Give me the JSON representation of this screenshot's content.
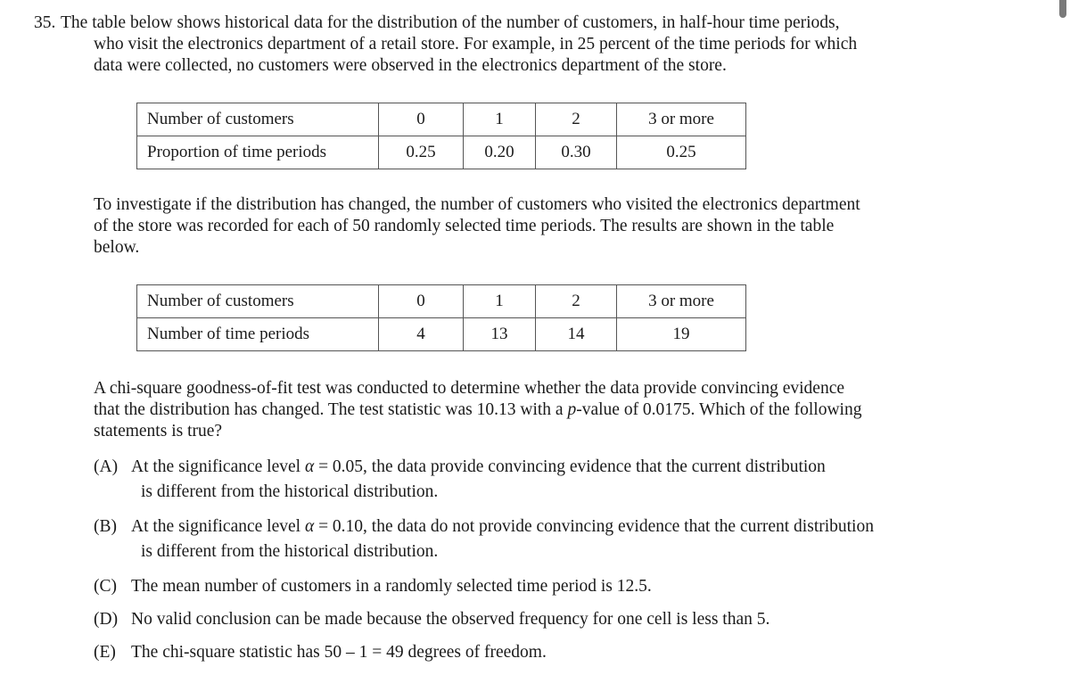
{
  "question": {
    "number": "35.",
    "intro_lines": [
      "The table below shows historical data for the distribution of the number of customers, in half-hour time periods,",
      "who visit the electronics department of a retail store. For example, in 25 percent of the time periods for which",
      "data were collected, no customers were observed in the electronics department of the store."
    ],
    "table1": {
      "row1_label": "Number of customers",
      "row1": [
        "0",
        "1",
        "2",
        "3 or more"
      ],
      "row2_label": "Proportion of time periods",
      "row2": [
        "0.25",
        "0.20",
        "0.30",
        "0.25"
      ]
    },
    "para2_lines": [
      "To investigate if the distribution has changed, the number of customers who visited the electronics department",
      "of the store was recorded for each of 50 randomly selected time periods. The results are shown in the table",
      "below."
    ],
    "table2": {
      "row1_label": "Number of customers",
      "row1": [
        "0",
        "1",
        "2",
        "3 or more"
      ],
      "row2_label": "Number of time periods",
      "row2": [
        "4",
        "13",
        "14",
        "19"
      ]
    },
    "para3": {
      "line1": "A chi-square goodness-of-fit test was conducted to determine whether the data provide convincing evidence",
      "line2_pre": "that the distribution has changed. The test statistic was 10.13 with a ",
      "line2_p": "p",
      "line2_post": "-value of 0.0175. Which of the following",
      "line3": "statements is true?"
    },
    "choices": [
      {
        "letter": "(A)",
        "pre": "At the significance level ",
        "alpha": "α",
        "post": " = 0.05,  the data provide convincing evidence that the current distribution",
        "cont": "is different from the historical distribution."
      },
      {
        "letter": "(B)",
        "pre": "At the significance level ",
        "alpha": "α",
        "post": " = 0.10,  the data do not provide convincing evidence that the current distribution",
        "cont": "is different from the historical distribution."
      },
      {
        "letter": "(C)",
        "text": "The mean number of customers in a randomly selected time period is 12.5."
      },
      {
        "letter": "(D)",
        "text": "No valid conclusion can be made because the observed frequency for one cell is less than 5."
      },
      {
        "letter": "(E)",
        "text": "The chi-square statistic has  50 – 1 = 49  degrees of freedom."
      }
    ]
  }
}
